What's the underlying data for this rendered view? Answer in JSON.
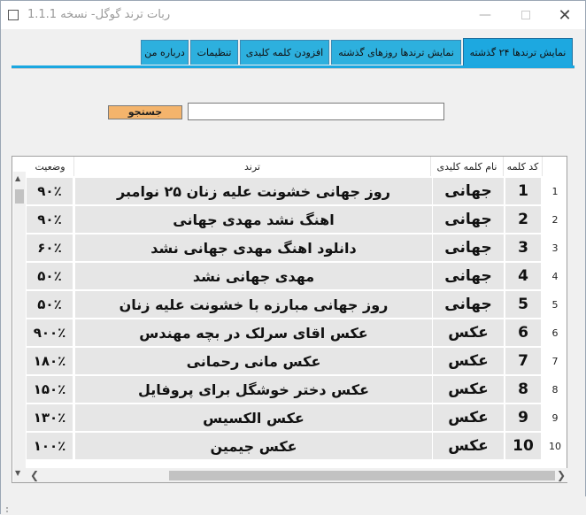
{
  "window": {
    "title": "ربات ترند گوگل- نسخه 1.1.1",
    "minimize_icon": "minimize-icon",
    "maximize_icon": "maximize-icon",
    "close_icon": "close-icon"
  },
  "tabs": [
    {
      "label": "نمایش ترندها ۲۴ گذشته",
      "active": true
    },
    {
      "label": "نمایش ترندها روزهای گذشته",
      "active": false
    },
    {
      "label": "افزودن کلمه کلیدی",
      "active": false
    },
    {
      "label": "تنظیمات",
      "active": false
    },
    {
      "label": "درباره من",
      "active": false
    }
  ],
  "search": {
    "button_label": "جستجو",
    "input_value": "",
    "accent_color": "#f4b46c"
  },
  "table": {
    "headers": {
      "status": "وضعیت",
      "trend": "ترند",
      "keyword": "نام کلمه کلیدی",
      "code": "کد کلمه"
    },
    "rows": [
      {
        "idx": "1",
        "code": "1",
        "keyword": "جهانی",
        "trend": "روز جهانی خشونت علیه زنان ۲۵ نوامبر",
        "status": "۹۰٪"
      },
      {
        "idx": "2",
        "code": "2",
        "keyword": "جهانی",
        "trend": "اهنگ نشد مهدی جهانی",
        "status": "۹۰٪"
      },
      {
        "idx": "3",
        "code": "3",
        "keyword": "جهانی",
        "trend": "دانلود اهنگ مهدی جهانی نشد",
        "status": "۶۰٪"
      },
      {
        "idx": "4",
        "code": "4",
        "keyword": "جهانی",
        "trend": "مهدی جهانی نشد",
        "status": "۵۰٪"
      },
      {
        "idx": "5",
        "code": "5",
        "keyword": "جهانی",
        "trend": "روز جهانی مبارزه با خشونت علیه زنان",
        "status": "۵۰٪"
      },
      {
        "idx": "6",
        "code": "6",
        "keyword": "عکس",
        "trend": "عکس اقای سرلک در بچه مهندس",
        "status": "۹۰۰٪"
      },
      {
        "idx": "7",
        "code": "7",
        "keyword": "عکس",
        "trend": "عکس مانی رحمانی",
        "status": "۱۸۰٪"
      },
      {
        "idx": "8",
        "code": "8",
        "keyword": "عکس",
        "trend": "عکس دختر خوشگل برای پروفایل",
        "status": "۱۵۰٪"
      },
      {
        "idx": "9",
        "code": "9",
        "keyword": "عکس",
        "trend": "عکس الکسیس",
        "status": "۱۳۰٪"
      },
      {
        "idx": "10",
        "code": "10",
        "keyword": "عکس",
        "trend": "عکس جیمین",
        "status": "۱۰۰٪"
      }
    ]
  },
  "colors": {
    "tab_bg": "#2db0de",
    "cell_bg": "#e6e6e6"
  }
}
